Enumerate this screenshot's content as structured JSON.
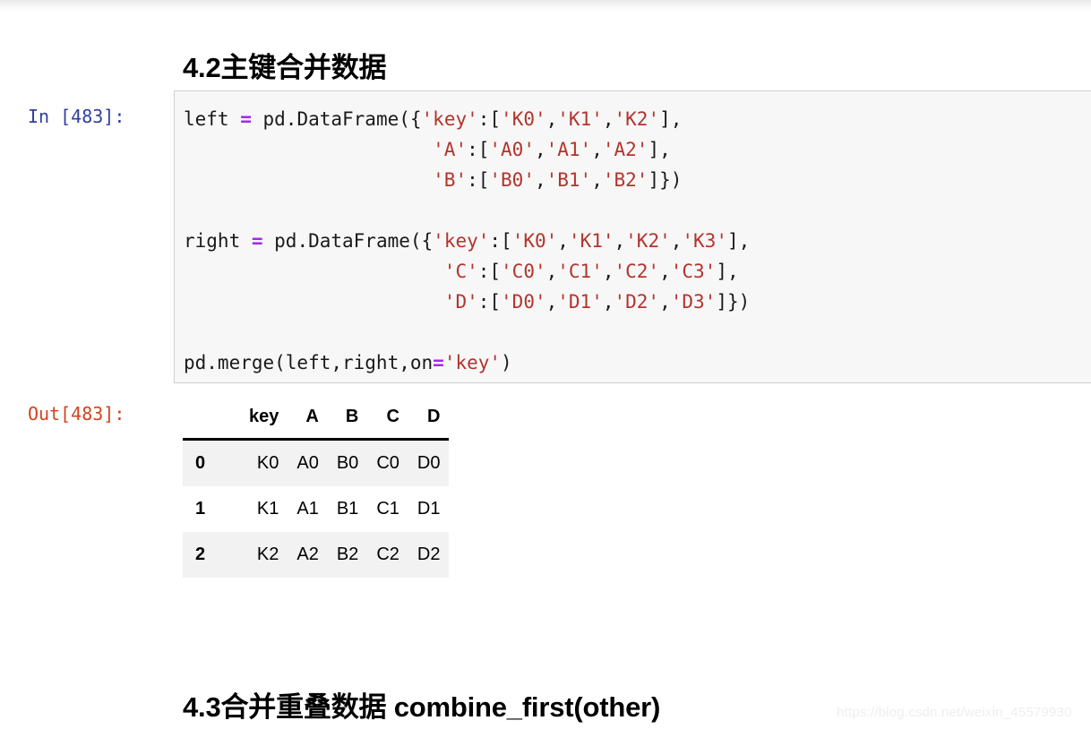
{
  "headings": {
    "section_42": "4.2主键合并数据",
    "section_43": "4.3合并重叠数据 combine_first(other)"
  },
  "input_cell": {
    "prompt": "In [483]:",
    "lines": [
      {
        "tokens": [
          {
            "t": "plain",
            "v": "left "
          },
          {
            "t": "op",
            "v": "="
          },
          {
            "t": "plain",
            "v": " pd.DataFrame({"
          },
          {
            "t": "str",
            "v": "'key'"
          },
          {
            "t": "plain",
            "v": ":["
          },
          {
            "t": "str",
            "v": "'K0'"
          },
          {
            "t": "plain",
            "v": ","
          },
          {
            "t": "str",
            "v": "'K1'"
          },
          {
            "t": "plain",
            "v": ","
          },
          {
            "t": "str",
            "v": "'K2'"
          },
          {
            "t": "plain",
            "v": "],"
          }
        ]
      },
      {
        "tokens": [
          {
            "t": "plain",
            "v": "                      "
          },
          {
            "t": "str",
            "v": "'A'"
          },
          {
            "t": "plain",
            "v": ":["
          },
          {
            "t": "str",
            "v": "'A0'"
          },
          {
            "t": "plain",
            "v": ","
          },
          {
            "t": "str",
            "v": "'A1'"
          },
          {
            "t": "plain",
            "v": ","
          },
          {
            "t": "str",
            "v": "'A2'"
          },
          {
            "t": "plain",
            "v": "],"
          }
        ]
      },
      {
        "tokens": [
          {
            "t": "plain",
            "v": "                      "
          },
          {
            "t": "str",
            "v": "'B'"
          },
          {
            "t": "plain",
            "v": ":["
          },
          {
            "t": "str",
            "v": "'B0'"
          },
          {
            "t": "plain",
            "v": ","
          },
          {
            "t": "str",
            "v": "'B1'"
          },
          {
            "t": "plain",
            "v": ","
          },
          {
            "t": "str",
            "v": "'B2'"
          },
          {
            "t": "plain",
            "v": "]})"
          }
        ]
      },
      {
        "blank": true,
        "tokens": []
      },
      {
        "tokens": [
          {
            "t": "plain",
            "v": "right "
          },
          {
            "t": "op",
            "v": "="
          },
          {
            "t": "plain",
            "v": " pd.DataFrame({"
          },
          {
            "t": "str",
            "v": "'key'"
          },
          {
            "t": "plain",
            "v": ":["
          },
          {
            "t": "str",
            "v": "'K0'"
          },
          {
            "t": "plain",
            "v": ","
          },
          {
            "t": "str",
            "v": "'K1'"
          },
          {
            "t": "plain",
            "v": ","
          },
          {
            "t": "str",
            "v": "'K2'"
          },
          {
            "t": "plain",
            "v": ","
          },
          {
            "t": "str",
            "v": "'K3'"
          },
          {
            "t": "plain",
            "v": "],"
          }
        ]
      },
      {
        "tokens": [
          {
            "t": "plain",
            "v": "                       "
          },
          {
            "t": "str",
            "v": "'C'"
          },
          {
            "t": "plain",
            "v": ":["
          },
          {
            "t": "str",
            "v": "'C0'"
          },
          {
            "t": "plain",
            "v": ","
          },
          {
            "t": "str",
            "v": "'C1'"
          },
          {
            "t": "plain",
            "v": ","
          },
          {
            "t": "str",
            "v": "'C2'"
          },
          {
            "t": "plain",
            "v": ","
          },
          {
            "t": "str",
            "v": "'C3'"
          },
          {
            "t": "plain",
            "v": "],"
          }
        ]
      },
      {
        "tokens": [
          {
            "t": "plain",
            "v": "                       "
          },
          {
            "t": "str",
            "v": "'D'"
          },
          {
            "t": "plain",
            "v": ":["
          },
          {
            "t": "str",
            "v": "'D0'"
          },
          {
            "t": "plain",
            "v": ","
          },
          {
            "t": "str",
            "v": "'D1'"
          },
          {
            "t": "plain",
            "v": ","
          },
          {
            "t": "str",
            "v": "'D2'"
          },
          {
            "t": "plain",
            "v": ","
          },
          {
            "t": "str",
            "v": "'D3'"
          },
          {
            "t": "plain",
            "v": "]})"
          }
        ]
      },
      {
        "blank": true,
        "tokens": []
      },
      {
        "tokens": [
          {
            "t": "plain",
            "v": "pd.merge(left,right,on"
          },
          {
            "t": "op",
            "v": "="
          },
          {
            "t": "str",
            "v": "'key'"
          },
          {
            "t": "plain",
            "v": ")"
          }
        ]
      }
    ]
  },
  "output_cell": {
    "prompt": "Out[483]:",
    "table": {
      "index_header": "",
      "columns": [
        "key",
        "A",
        "B",
        "C",
        "D"
      ],
      "rows": [
        {
          "index": "0",
          "cells": [
            "K0",
            "A0",
            "B0",
            "C0",
            "D0"
          ]
        },
        {
          "index": "1",
          "cells": [
            "K1",
            "A1",
            "B1",
            "C1",
            "D1"
          ]
        },
        {
          "index": "2",
          "cells": [
            "K2",
            "A2",
            "B2",
            "C2",
            "D2"
          ]
        }
      ]
    }
  },
  "watermark": {
    "text": "https://blog.csdn.net/weixin_45579930"
  },
  "colors": {
    "prompt_in": "#303f9f",
    "prompt_out": "#d1441e",
    "code_string": "#b3342c",
    "code_operator": "#a626f0",
    "cell_background": "#f7f7f7",
    "cell_border": "#cfcfcf",
    "table_stripe": "#f2f2f2"
  }
}
